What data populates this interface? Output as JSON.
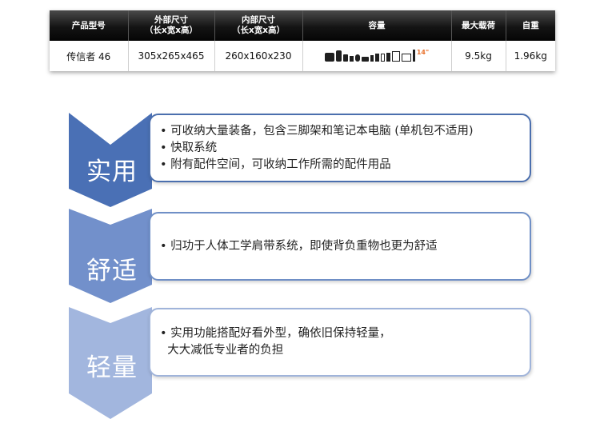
{
  "table": {
    "headers": [
      "产品型号",
      "外部尺寸\n（长x宽x高）",
      "内部尺寸\n（长x宽x高）",
      "容量",
      "最大载荷",
      "自重"
    ],
    "row": {
      "model": "传信者 46",
      "outer": "305x265x465",
      "inner": "260x160x230",
      "capacity_icons": [
        "camera-body-icon",
        "lens-icon",
        "lens-icon",
        "flash-icon",
        "small-lens-icon",
        "camera-icon",
        "battery-icon",
        "battery-icon",
        "phone-icon",
        "phone-icon",
        "tablet-icon",
        "laptop-icon",
        "tripod-icon"
      ],
      "laptop_label": "14\"",
      "max_load": "9.5kg",
      "weight": "1.96kg"
    }
  },
  "features": [
    {
      "name": "实用",
      "bullets": [
        "• 可收纳大量装备，包含三脚架和笔记本电脑 (单机包不适用)",
        "• 快取系统",
        "• 附有配件空间，可收纳工作所需的配件用品"
      ],
      "color": "#4a70b5",
      "border": "#4b6fae"
    },
    {
      "name": "舒适",
      "bullets": [
        "• 归功于人体工学肩带系统，即使背负重物也更为舒适"
      ],
      "color": "#7290cb",
      "border": "#6f8fc6"
    },
    {
      "name": "轻量",
      "bullets": [
        "• 实用功能搭配好看外型，确依旧保持轻量，",
        "  大大减低专业者的负担"
      ],
      "color": "#a2b6de",
      "border": "#a0b4da"
    }
  ]
}
